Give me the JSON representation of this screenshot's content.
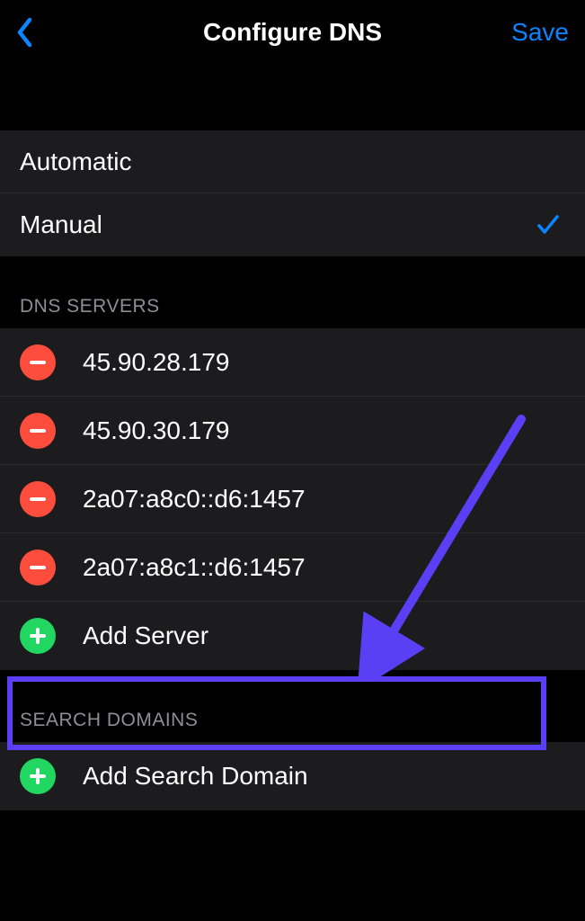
{
  "nav": {
    "title": "Configure DNS",
    "save_label": "Save"
  },
  "mode_options": {
    "automatic": "Automatic",
    "manual": "Manual",
    "selected": "manual"
  },
  "dns_section": {
    "header": "DNS SERVERS",
    "servers": [
      "45.90.28.179",
      "45.90.30.179",
      "2a07:a8c0::d6:1457",
      "2a07:a8c1::d6:1457"
    ],
    "add_label": "Add Server"
  },
  "search_section": {
    "header": "SEARCH DOMAINS",
    "add_label": "Add Search Domain"
  },
  "colors": {
    "accent_blue": "#0a84ff",
    "delete_red": "#ff4d3d",
    "add_green": "#22d761",
    "highlight": "#5b3ff5"
  }
}
